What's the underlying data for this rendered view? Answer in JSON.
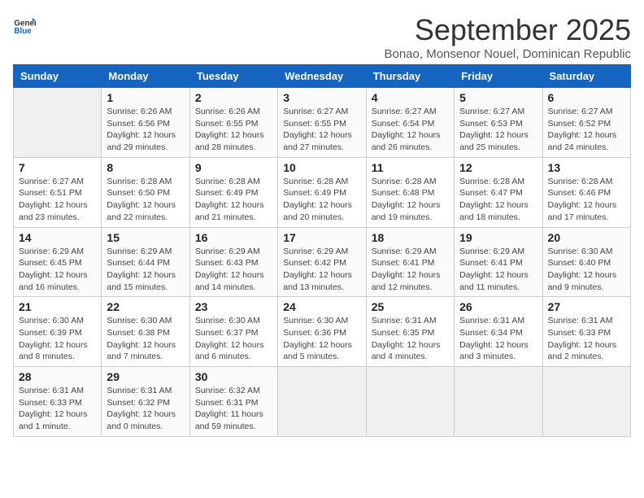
{
  "logo": {
    "general": "General",
    "blue": "Blue"
  },
  "title": "September 2025",
  "subtitle": "Bonao, Monsenor Nouel, Dominican Republic",
  "days_of_week": [
    "Sunday",
    "Monday",
    "Tuesday",
    "Wednesday",
    "Thursday",
    "Friday",
    "Saturday"
  ],
  "weeks": [
    [
      {
        "day": "",
        "info": ""
      },
      {
        "day": "1",
        "info": "Sunrise: 6:26 AM\nSunset: 6:56 PM\nDaylight: 12 hours and 29 minutes."
      },
      {
        "day": "2",
        "info": "Sunrise: 6:26 AM\nSunset: 6:55 PM\nDaylight: 12 hours and 28 minutes."
      },
      {
        "day": "3",
        "info": "Sunrise: 6:27 AM\nSunset: 6:55 PM\nDaylight: 12 hours and 27 minutes."
      },
      {
        "day": "4",
        "info": "Sunrise: 6:27 AM\nSunset: 6:54 PM\nDaylight: 12 hours and 26 minutes."
      },
      {
        "day": "5",
        "info": "Sunrise: 6:27 AM\nSunset: 6:53 PM\nDaylight: 12 hours and 25 minutes."
      },
      {
        "day": "6",
        "info": "Sunrise: 6:27 AM\nSunset: 6:52 PM\nDaylight: 12 hours and 24 minutes."
      }
    ],
    [
      {
        "day": "7",
        "info": "Sunrise: 6:27 AM\nSunset: 6:51 PM\nDaylight: 12 hours and 23 minutes."
      },
      {
        "day": "8",
        "info": "Sunrise: 6:28 AM\nSunset: 6:50 PM\nDaylight: 12 hours and 22 minutes."
      },
      {
        "day": "9",
        "info": "Sunrise: 6:28 AM\nSunset: 6:49 PM\nDaylight: 12 hours and 21 minutes."
      },
      {
        "day": "10",
        "info": "Sunrise: 6:28 AM\nSunset: 6:49 PM\nDaylight: 12 hours and 20 minutes."
      },
      {
        "day": "11",
        "info": "Sunrise: 6:28 AM\nSunset: 6:48 PM\nDaylight: 12 hours and 19 minutes."
      },
      {
        "day": "12",
        "info": "Sunrise: 6:28 AM\nSunset: 6:47 PM\nDaylight: 12 hours and 18 minutes."
      },
      {
        "day": "13",
        "info": "Sunrise: 6:28 AM\nSunset: 6:46 PM\nDaylight: 12 hours and 17 minutes."
      }
    ],
    [
      {
        "day": "14",
        "info": "Sunrise: 6:29 AM\nSunset: 6:45 PM\nDaylight: 12 hours and 16 minutes."
      },
      {
        "day": "15",
        "info": "Sunrise: 6:29 AM\nSunset: 6:44 PM\nDaylight: 12 hours and 15 minutes."
      },
      {
        "day": "16",
        "info": "Sunrise: 6:29 AM\nSunset: 6:43 PM\nDaylight: 12 hours and 14 minutes."
      },
      {
        "day": "17",
        "info": "Sunrise: 6:29 AM\nSunset: 6:42 PM\nDaylight: 12 hours and 13 minutes."
      },
      {
        "day": "18",
        "info": "Sunrise: 6:29 AM\nSunset: 6:41 PM\nDaylight: 12 hours and 12 minutes."
      },
      {
        "day": "19",
        "info": "Sunrise: 6:29 AM\nSunset: 6:41 PM\nDaylight: 12 hours and 11 minutes."
      },
      {
        "day": "20",
        "info": "Sunrise: 6:30 AM\nSunset: 6:40 PM\nDaylight: 12 hours and 9 minutes."
      }
    ],
    [
      {
        "day": "21",
        "info": "Sunrise: 6:30 AM\nSunset: 6:39 PM\nDaylight: 12 hours and 8 minutes."
      },
      {
        "day": "22",
        "info": "Sunrise: 6:30 AM\nSunset: 6:38 PM\nDaylight: 12 hours and 7 minutes."
      },
      {
        "day": "23",
        "info": "Sunrise: 6:30 AM\nSunset: 6:37 PM\nDaylight: 12 hours and 6 minutes."
      },
      {
        "day": "24",
        "info": "Sunrise: 6:30 AM\nSunset: 6:36 PM\nDaylight: 12 hours and 5 minutes."
      },
      {
        "day": "25",
        "info": "Sunrise: 6:31 AM\nSunset: 6:35 PM\nDaylight: 12 hours and 4 minutes."
      },
      {
        "day": "26",
        "info": "Sunrise: 6:31 AM\nSunset: 6:34 PM\nDaylight: 12 hours and 3 minutes."
      },
      {
        "day": "27",
        "info": "Sunrise: 6:31 AM\nSunset: 6:33 PM\nDaylight: 12 hours and 2 minutes."
      }
    ],
    [
      {
        "day": "28",
        "info": "Sunrise: 6:31 AM\nSunset: 6:33 PM\nDaylight: 12 hours and 1 minute."
      },
      {
        "day": "29",
        "info": "Sunrise: 6:31 AM\nSunset: 6:32 PM\nDaylight: 12 hours and 0 minutes."
      },
      {
        "day": "30",
        "info": "Sunrise: 6:32 AM\nSunset: 6:31 PM\nDaylight: 11 hours and 59 minutes."
      },
      {
        "day": "",
        "info": ""
      },
      {
        "day": "",
        "info": ""
      },
      {
        "day": "",
        "info": ""
      },
      {
        "day": "",
        "info": ""
      }
    ]
  ]
}
